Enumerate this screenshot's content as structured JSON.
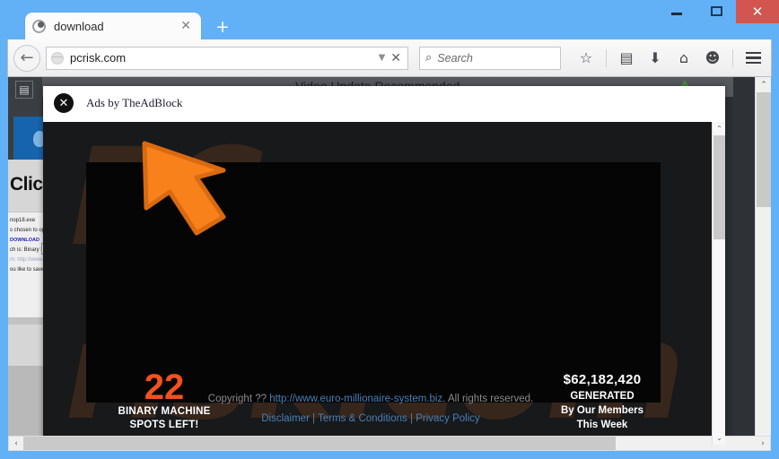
{
  "window": {
    "minimize_label": "—",
    "maximize_label": "□",
    "close_label": "✕"
  },
  "tabs": {
    "active": {
      "title": "download",
      "close_label": "✕",
      "favicon": "loading-circle-icon"
    },
    "new_tab_label": "+"
  },
  "navbar": {
    "back_label": "←",
    "url": "pcrisk.com",
    "url_dropdown_label": "▼",
    "url_clear_label": "✕",
    "search_placeholder": "Search",
    "search_icon_label": "⌕",
    "icons": [
      {
        "name": "bookmark-star-icon",
        "glyph": "☆"
      },
      {
        "name": "reading-list-icon",
        "glyph": "▤"
      },
      {
        "name": "downloads-icon",
        "glyph": "⬇"
      },
      {
        "name": "home-icon",
        "glyph": "⌂"
      },
      {
        "name": "sync-chat-icon",
        "glyph": "☻"
      }
    ]
  },
  "background_page": {
    "header_title": "Video Update Recommended",
    "click_text": "Click",
    "dialog_lines": [
      "nop18.exe",
      "s chosen to open",
      "DOWNLOAD",
      "ch is: Binary File",
      "m: http://www...",
      "ou like to save thi"
    ],
    "doc_icon": "document-icon"
  },
  "ad_overlay": {
    "close_label": "✕",
    "label": "Ads by TheAdBlock",
    "cursor": "orange-arrow-cursor",
    "watermark_line1": "PC",
    "watermark_line2": "risk.com",
    "spots": {
      "number": "22",
      "line1": "BINARY MACHINE",
      "line2": "SPOTS LEFT!"
    },
    "money": {
      "amount": "$62,182,420",
      "line1": "GENERATED",
      "line2": "By Our Members",
      "line3": "This Week"
    },
    "legal": {
      "copyright_prefix": "Copyright ?? ",
      "copyright_link": "http://www.euro-millionaire-system.biz",
      "copyright_suffix": ". All rights reserved.",
      "links": [
        "Disclaimer",
        "Terms & Conditions",
        "Privacy Policy"
      ],
      "separator": " | "
    }
  },
  "scrollbars": {
    "up_label": "⌃",
    "down_label": "⌄",
    "left_label": "‹",
    "right_label": "›"
  },
  "colors": {
    "window_frame": "#62b1f6",
    "close_button": "#d2564f",
    "accent_orange": "#f4511e",
    "link_blue": "#4a7fb5"
  }
}
